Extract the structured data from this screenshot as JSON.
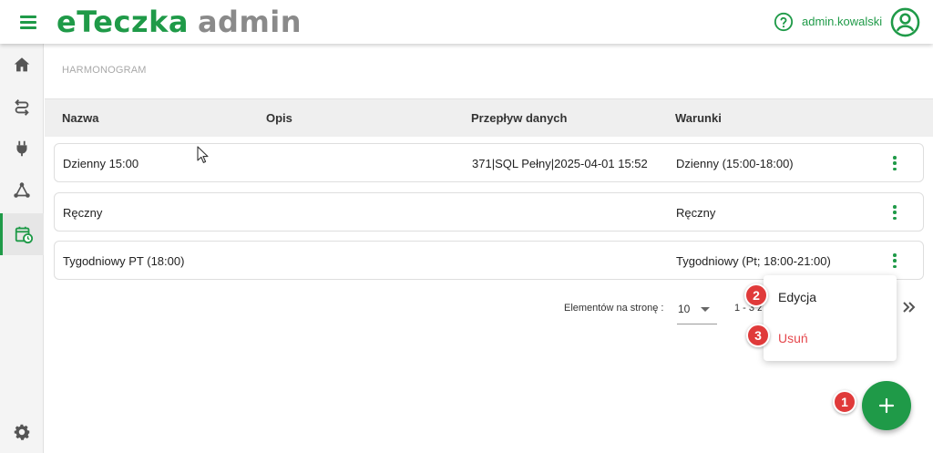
{
  "app": {
    "brand_primary": "eTeczka",
    "brand_secondary": "admin",
    "username": "admin.kowalski",
    "accent_color": "#1f9a48",
    "danger_color": "#e5484d"
  },
  "sidebar": {
    "items": [
      {
        "icon": "home-icon"
      },
      {
        "icon": "route-icon"
      },
      {
        "icon": "plug-icon"
      },
      {
        "icon": "network-icon"
      },
      {
        "icon": "calendar-clock-icon",
        "active": true
      }
    ],
    "bottom_icon": "gear-icon"
  },
  "breadcrumb": "HARMONOGRAM",
  "table": {
    "headers": [
      "Nazwa",
      "Opis",
      "Przepływ danych",
      "Warunki"
    ],
    "rows": [
      {
        "nazwa": "Dzienny 15:00",
        "opis": "",
        "przeplyw": "371|SQL Pełny|2025-04-01 15:52",
        "warunki": "Dzienny (15:00-18:00)"
      },
      {
        "nazwa": "Ręczny",
        "opis": "",
        "przeplyw": "",
        "warunki": "Ręczny"
      },
      {
        "nazwa": "Tygodniowy PT (18:00)",
        "opis": "",
        "przeplyw": "",
        "warunki": "Tygodniowy (Pt; 18:00-21:00)"
      }
    ]
  },
  "pagination": {
    "label": "Elementów na stronę :",
    "page_size": "10",
    "range": "1 - 3 z"
  },
  "context_menu": {
    "edit_label": "Edycja",
    "delete_label": "Usuń"
  },
  "annotations": {
    "badge_add": "1",
    "badge_edit": "2",
    "badge_delete": "3"
  },
  "fab": {
    "icon": "plus-icon"
  }
}
